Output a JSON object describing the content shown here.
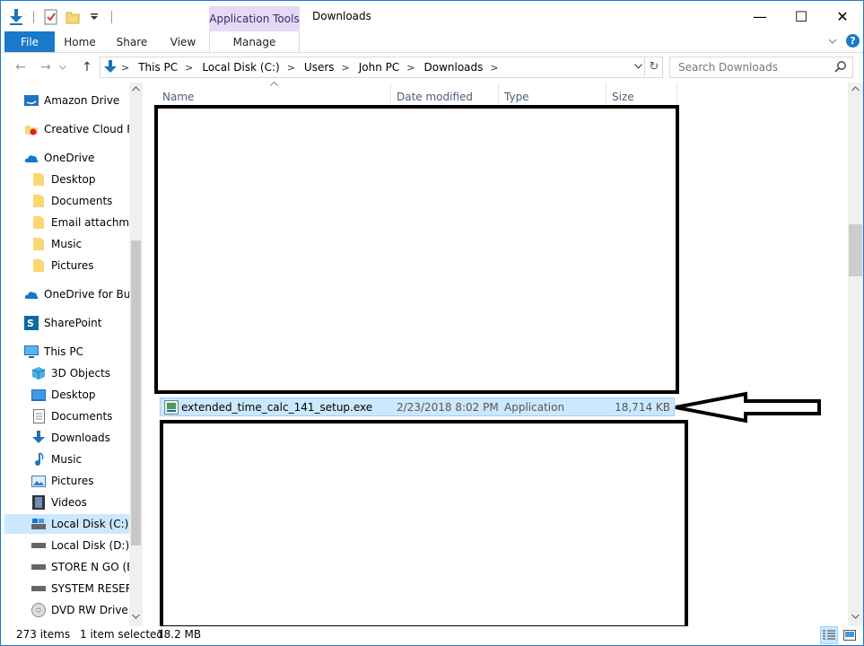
{
  "window": {
    "title": "Downloads",
    "context_group": "Application Tools",
    "minimize_glyph": "—",
    "maximize_glyph": "☐",
    "close_glyph": "✕"
  },
  "ribbon": {
    "tabs": [
      {
        "label": "File"
      },
      {
        "label": "Home"
      },
      {
        "label": "Share"
      },
      {
        "label": "View"
      },
      {
        "label": "Manage"
      }
    ]
  },
  "address": {
    "crumbs": [
      "This PC",
      "Local Disk (C:)",
      "Users",
      "John PC",
      "Downloads"
    ],
    "separator": ">"
  },
  "search": {
    "placeholder": "Search Downloads"
  },
  "nav": {
    "items": [
      {
        "label": "Amazon Drive",
        "icon": "amazon-drive-icon"
      },
      {
        "label": "Creative Cloud Files",
        "icon": "creative-cloud-icon"
      },
      {
        "label": "OneDrive",
        "icon": "cloud-icon"
      },
      {
        "label": "Desktop",
        "icon": "folder-icon"
      },
      {
        "label": "Documents",
        "icon": "folder-icon"
      },
      {
        "label": "Email attachments",
        "icon": "folder-icon"
      },
      {
        "label": "Music",
        "icon": "folder-icon"
      },
      {
        "label": "Pictures",
        "icon": "folder-icon"
      },
      {
        "label": "OneDrive for Business",
        "icon": "cloud-icon"
      },
      {
        "label": "SharePoint",
        "icon": "sharepoint-icon"
      },
      {
        "label": "This PC",
        "icon": "computer-icon"
      },
      {
        "label": "3D Objects",
        "icon": "cube-icon"
      },
      {
        "label": "Desktop",
        "icon": "desktop-icon"
      },
      {
        "label": "Documents",
        "icon": "document-icon"
      },
      {
        "label": "Downloads",
        "icon": "download-icon"
      },
      {
        "label": "Music",
        "icon": "music-icon"
      },
      {
        "label": "Pictures",
        "icon": "picture-icon"
      },
      {
        "label": "Videos",
        "icon": "video-icon"
      },
      {
        "label": "Local Disk (C:)",
        "icon": "drive-icon",
        "selected": true
      },
      {
        "label": "Local Disk (D:)",
        "icon": "drive-icon"
      },
      {
        "label": "STORE N GO (E:)",
        "icon": "drive-icon"
      },
      {
        "label": "SYSTEM RESERVED",
        "icon": "drive-icon"
      },
      {
        "label": "DVD RW Drive (G:)",
        "icon": "dvd-icon"
      }
    ]
  },
  "columns": {
    "name": "Name",
    "date": "Date modified",
    "type": "Type",
    "size": "Size"
  },
  "file": {
    "name": "extended_time_calc_141_setup.exe",
    "date": "2/23/2018 8:02 PM",
    "type": "Application",
    "size": "18,714 KB"
  },
  "status": {
    "items": "273 items",
    "selected": "1 item selected",
    "size": "18.2 MB"
  }
}
